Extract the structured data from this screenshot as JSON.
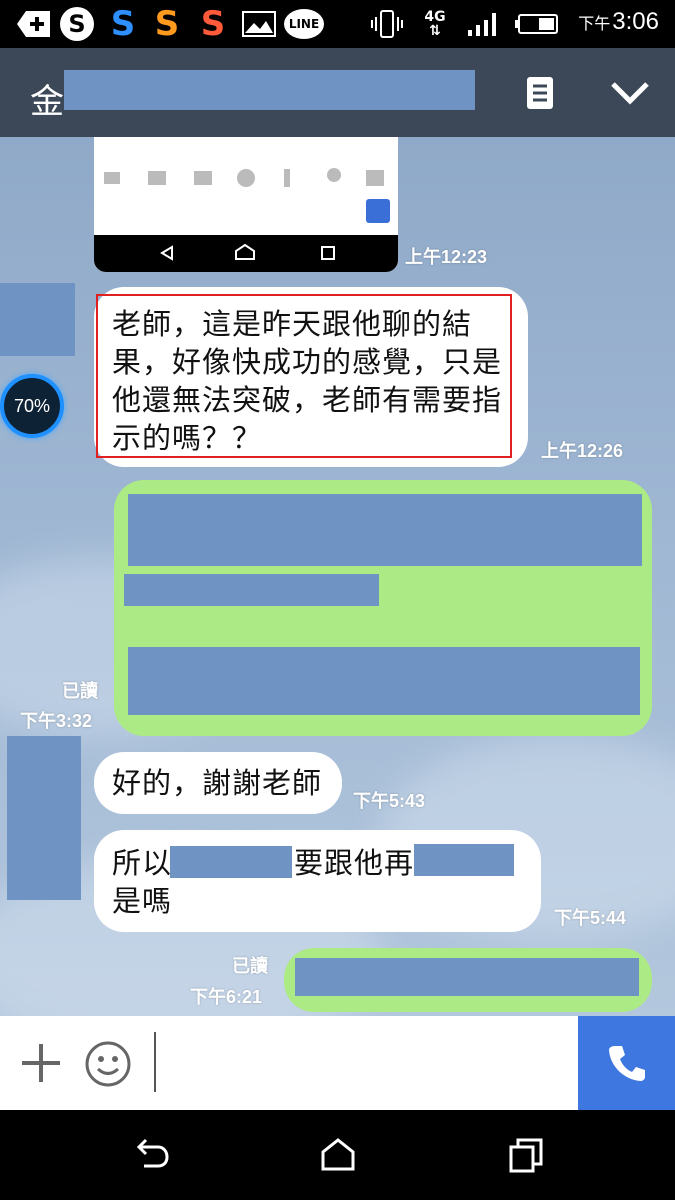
{
  "status_bar": {
    "time_prefix": "下午",
    "time": "3:06",
    "network": "4G",
    "icons": [
      "add-icon",
      "skype-icon",
      "s-app-icon-blue",
      "s-app-icon-orange",
      "s-app-icon-red",
      "image-icon",
      "line-app-icon",
      "vibrate-icon",
      "network-4g-icon",
      "signal-icon",
      "battery-icon"
    ]
  },
  "header": {
    "title": "金",
    "menu_icon": "list-icon",
    "collapse_icon": "chevron-down-icon"
  },
  "overlay": {
    "badge_percent": "70%"
  },
  "messages": [
    {
      "id": "m1",
      "side": "left",
      "type": "image",
      "time": "上午12:23"
    },
    {
      "id": "m2",
      "side": "left",
      "text": "老師，這是昨天跟他聊的結果，好像快成功的感覺，只是他還無法突破，老師有需要指示的嗎？？",
      "lines": [
        "老師，這是昨天跟他聊的結",
        "果，好像快成功的感覺，只是",
        "他還無法突破，老師有需要指",
        "示的嗎？？"
      ],
      "time": "上午12:26",
      "highlighted": true
    },
    {
      "id": "m3",
      "side": "right",
      "text_redacted": true,
      "read": "已讀",
      "time": "下午3:32"
    },
    {
      "id": "m4",
      "side": "left",
      "text": "好的，謝謝老師",
      "time": "下午5:43"
    },
    {
      "id": "m5",
      "side": "left",
      "line1_a": "所以",
      "line1_b": "要跟他再",
      "line2": "是嗎",
      "time": "下午5:44"
    },
    {
      "id": "m6",
      "side": "right",
      "text_redacted": true,
      "read": "已讀",
      "time": "下午6:21"
    }
  ],
  "input_bar": {
    "add_icon": "plus-icon",
    "emoji_icon": "smiley-icon",
    "call_icon": "phone-icon"
  },
  "nav_bar": {
    "icons": [
      "back-icon",
      "home-icon",
      "recents-icon"
    ]
  },
  "colors": {
    "header_bg": "#3c4858",
    "sent_bubble": "#acea85",
    "received_bubble": "#ffffff",
    "redaction": "#6f93c2",
    "call_button": "#3f77e0",
    "highlight_border": "#e02020"
  }
}
